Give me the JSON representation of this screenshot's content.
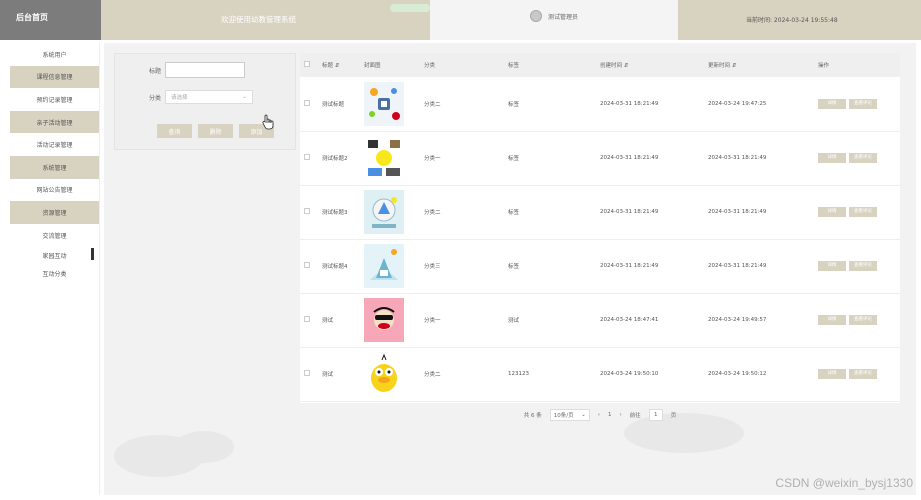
{
  "header": {
    "brand": "后台首页",
    "site_title": "欢迎使用幼教管理系统",
    "user_name": "测试管理员",
    "time_label": "当前时间: 2024-03-24 19:55:48"
  },
  "sidebar": {
    "items": [
      {
        "label": "系统用户"
      },
      {
        "label": "课程信息管理"
      },
      {
        "label": "预约记录管理"
      },
      {
        "label": "亲子活动管理"
      },
      {
        "label": "活动记录管理"
      },
      {
        "label": "系统管理"
      },
      {
        "label": "网站公告管理"
      },
      {
        "label": "资源管理"
      },
      {
        "label": "交流管理"
      }
    ],
    "subitems": [
      {
        "label": "家园互动"
      },
      {
        "label": "互动分类"
      }
    ]
  },
  "search": {
    "title_label": "标题",
    "category_label": "分类",
    "category_placeholder": "请选择",
    "query_btn": "查询",
    "delete_btn": "删除",
    "add_btn": "添加"
  },
  "table": {
    "columns": [
      "标题",
      "封面图",
      "分类",
      "标签",
      "创建时间",
      "更新时间",
      "操作"
    ],
    "rows": [
      {
        "title": "测试标题",
        "category": "分类二",
        "tag": "标签",
        "created": "2024-03-31 18:21:49",
        "updated": "2024-03-24 19:47:25"
      },
      {
        "title": "测试标题2",
        "category": "分类一",
        "tag": "标签",
        "created": "2024-03-31 18:21:49",
        "updated": "2024-03-31 18:21:49"
      },
      {
        "title": "测试标题3",
        "category": "分类二",
        "tag": "标签",
        "created": "2024-03-31 18:21:49",
        "updated": "2024-03-31 18:21:49"
      },
      {
        "title": "测试标题4",
        "category": "分类三",
        "tag": "标签",
        "created": "2024-03-31 18:21:49",
        "updated": "2024-03-31 18:21:49"
      },
      {
        "title": "测试",
        "category": "分类一",
        "tag": "测试",
        "created": "2024-03-24 18:47:41",
        "updated": "2024-03-24 19:49:57"
      },
      {
        "title": "测试",
        "category": "分类二",
        "tag": "123123",
        "created": "2024-03-24 19:50:10",
        "updated": "2024-03-24 19:50:12"
      }
    ],
    "detail_btn": "详情",
    "comment_btn": "查看评论"
  },
  "pager": {
    "total": "共 6 条",
    "per_page": "10条/页",
    "current": "1",
    "goto_label": "前往",
    "goto_value": "1",
    "page_unit": "页",
    "prev": "‹",
    "next": "›"
  },
  "watermark": "CSDN @weixin_bysj1330",
  "colors": {
    "accent": "#d8d2c0",
    "brand_bg": "#7c7c7c"
  }
}
